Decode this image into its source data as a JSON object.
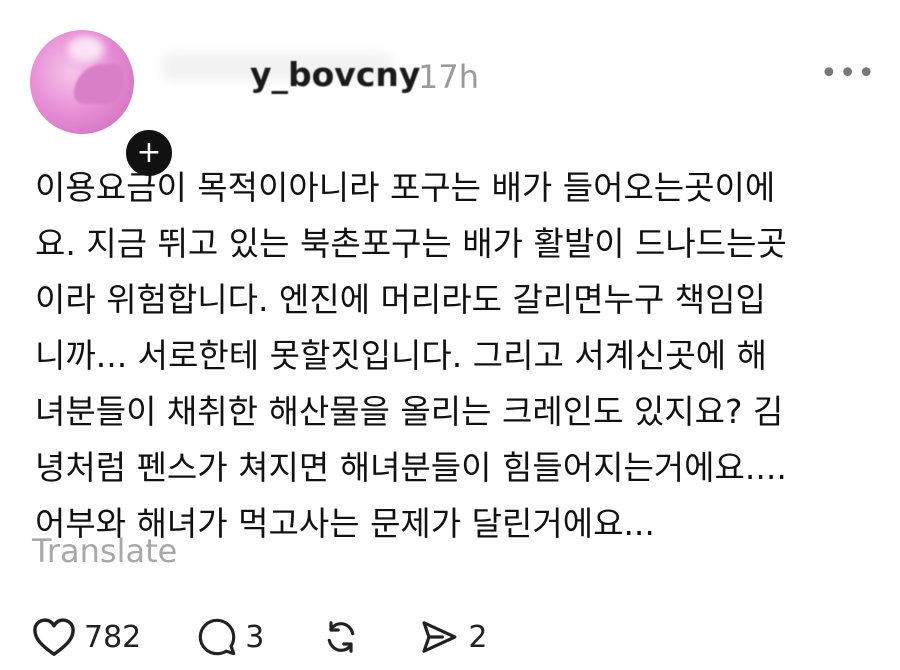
{
  "post": {
    "username_visible": "y_bovcny",
    "time": "17h",
    "more_label": "•••",
    "add_label": "+",
    "body_lines": [
      "이용요금이 목적이아니라 포구는 배가 들어오는곳이에",
      "요. 지금 뛰고 있는 북촌포구는 배가 활발이 드나드는곳",
      "이라 위험합니다. 엔진에 머리라도 갈리면누구 책임입",
      "니까... 서로한테 못할짓입니다. 그리고 서계신곳에 해",
      "녀분들이 채취한 해산물을 올리는 크레인도 있지요? 김",
      "녕처럼 펜스가 쳐지면 해녀분들이 힘들어지는거에요....",
      "어부와 해녀가 먹고사는 문제가 달린거에요..."
    ],
    "translate_label": "Translate"
  },
  "actions": {
    "like": {
      "icon": "heart-icon",
      "count": "782"
    },
    "comment": {
      "icon": "comment-icon",
      "count": "3"
    },
    "repost": {
      "icon": "repost-icon",
      "count": ""
    },
    "share": {
      "icon": "send-icon",
      "count": "2"
    }
  },
  "colors": {
    "text": "#111111",
    "muted": "#9a9a9a",
    "avatar_pink": "#e890d6",
    "badge": "#111111"
  }
}
